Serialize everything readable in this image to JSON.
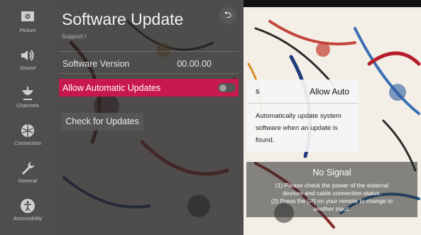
{
  "sidebar": {
    "items": [
      {
        "label": "Picture",
        "icon": "picture-icon"
      },
      {
        "label": "Sound",
        "icon": "sound-icon"
      },
      {
        "label": "Channels",
        "icon": "channels-icon"
      },
      {
        "label": "Connection",
        "icon": "connection-icon"
      },
      {
        "label": "General",
        "icon": "wrench-icon"
      },
      {
        "label": "Accessibility",
        "icon": "accessibility-icon"
      }
    ]
  },
  "panel": {
    "title": "Software Update",
    "breadcrumb": "Support /",
    "back_icon": "back-icon",
    "software_version_label": "Software Version",
    "software_version_value": "00.00.00",
    "auto_updates_label": "Allow Automatic Updates",
    "auto_updates_on": false,
    "check_button": "Check for Updates"
  },
  "tooltip": {
    "head_left": "s",
    "head_right": "Allow Auto",
    "body": "Automatically update system software when an update is found."
  },
  "no_signal": {
    "title": "No Signal",
    "line1": "(1) Please check the power of the external",
    "line2": "devices and cable connection status.",
    "line3": "(2) Press the [",
    "line3_icon": "input-icon",
    "line3b": "] on your remote to change to",
    "line4": "another input."
  },
  "colors": {
    "accent": "#c8194f",
    "panel_bg": "#242426"
  }
}
